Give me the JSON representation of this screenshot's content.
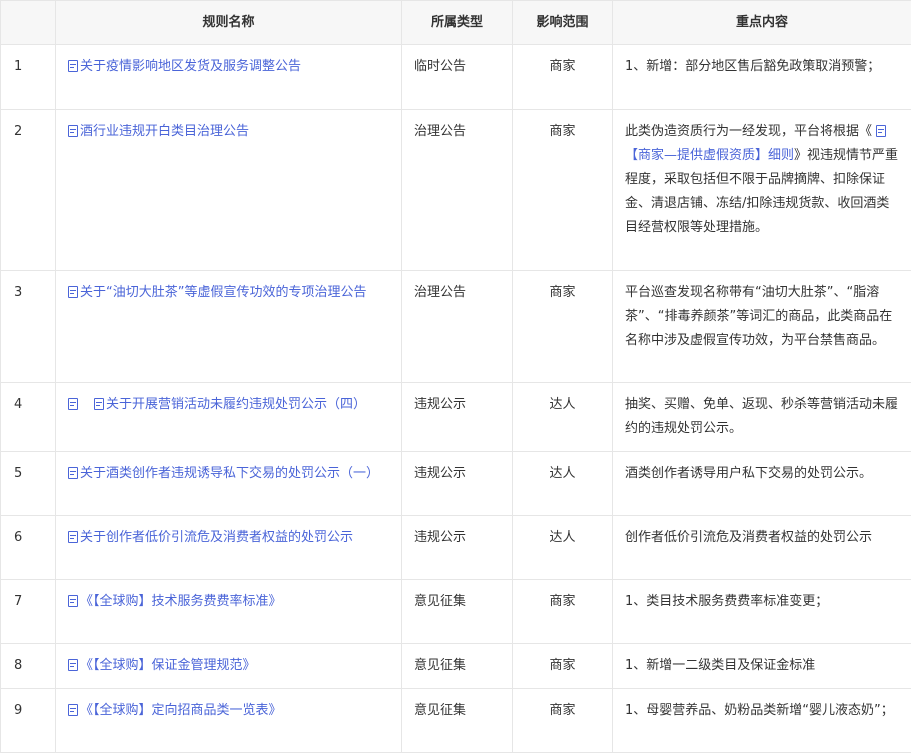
{
  "headers": {
    "num": "",
    "name": "规则名称",
    "type": "所属类型",
    "scope": "影响范围",
    "content": "重点内容"
  },
  "rows": [
    {
      "num": "1",
      "name": "关于疫情影响地区发货及服务调整公告",
      "type": "临时公告",
      "scope": "商家",
      "content": "1、新增：部分地区售后豁免政策取消预警；"
    },
    {
      "num": "2",
      "name": "酒行业违规开白类目治理公告",
      "type": "治理公告",
      "scope": "商家",
      "content_pre": "此类伪造资质行为一经发现，平台将根据《",
      "content_link": "【商家—提供虚假资质】细则",
      "content_post": "》视违规情节严重程度，采取包括但不限于品牌摘牌、扣除保证金、清退店铺、冻结/扣除违规货款、收回酒类目经营权限等处理措施。"
    },
    {
      "num": "3",
      "name": "关于“油切大肚茶”等虚假宣传功效的专项治理公告",
      "type": "治理公告",
      "scope": "商家",
      "content": "平台巡查发现名称带有“油切大肚茶”、“脂溶茶”、“排毒养颜茶”等词汇的商品，此类商品在名称中涉及虚假宣传功效，为平台禁售商品。"
    },
    {
      "num": "4",
      "name": "关于开展营销活动未履约违规处罚公示（四）",
      "type": "违规公示",
      "scope": "达人",
      "content": "抽奖、买赠、免单、返现、秒杀等营销活动未履约的违规处罚公示。"
    },
    {
      "num": "5",
      "name": "关于酒类创作者违规诱导私下交易的处罚公示（一）",
      "type": "违规公示",
      "scope": "达人",
      "content": "酒类创作者诱导用户私下交易的处罚公示。"
    },
    {
      "num": "6",
      "name": "关于创作者低价引流危及消费者权益的处罚公示",
      "type": "违规公示",
      "scope": "达人",
      "content": "创作者低价引流危及消费者权益的处罚公示"
    },
    {
      "num": "7",
      "name": "《【全球购】技术服务费费率标准》",
      "type": "意见征集",
      "scope": "商家",
      "content": "1、类目技术服务费费率标准变更；"
    },
    {
      "num": "8",
      "name": "《【全球购】保证金管理规范》",
      "type": "意见征集",
      "scope": "商家",
      "content": "1、新增一二级类目及保证金标准"
    },
    {
      "num": "9",
      "name": "《【全球购】定向招商品类一览表》",
      "type": "意见征集",
      "scope": "商家",
      "content": "1、母婴营养品、奶粉品类新增“婴儿液态奶”；"
    }
  ]
}
